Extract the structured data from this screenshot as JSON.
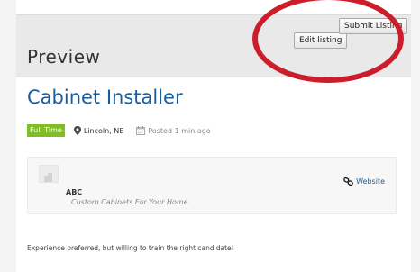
{
  "header": {
    "title": "Preview",
    "edit_label": "Edit listing",
    "submit_label": "Submit Listing"
  },
  "job": {
    "title": "Cabinet Installer",
    "type": "Full Time",
    "location": "Lincoln, NE",
    "posted": "Posted 1 min ago",
    "description": "Experience preferred, but willing to train the right candidate!"
  },
  "company": {
    "name": "ABC",
    "tagline": "Custom Cabinets For Your Home",
    "website_label": "Website"
  },
  "colors": {
    "accent_blue": "#1a5d9c",
    "badge_green": "#7fbf25",
    "highlight_red": "#cc1d2a"
  },
  "icons": [
    "map-pin-icon",
    "calendar-icon",
    "link-icon",
    "building-icon"
  ]
}
